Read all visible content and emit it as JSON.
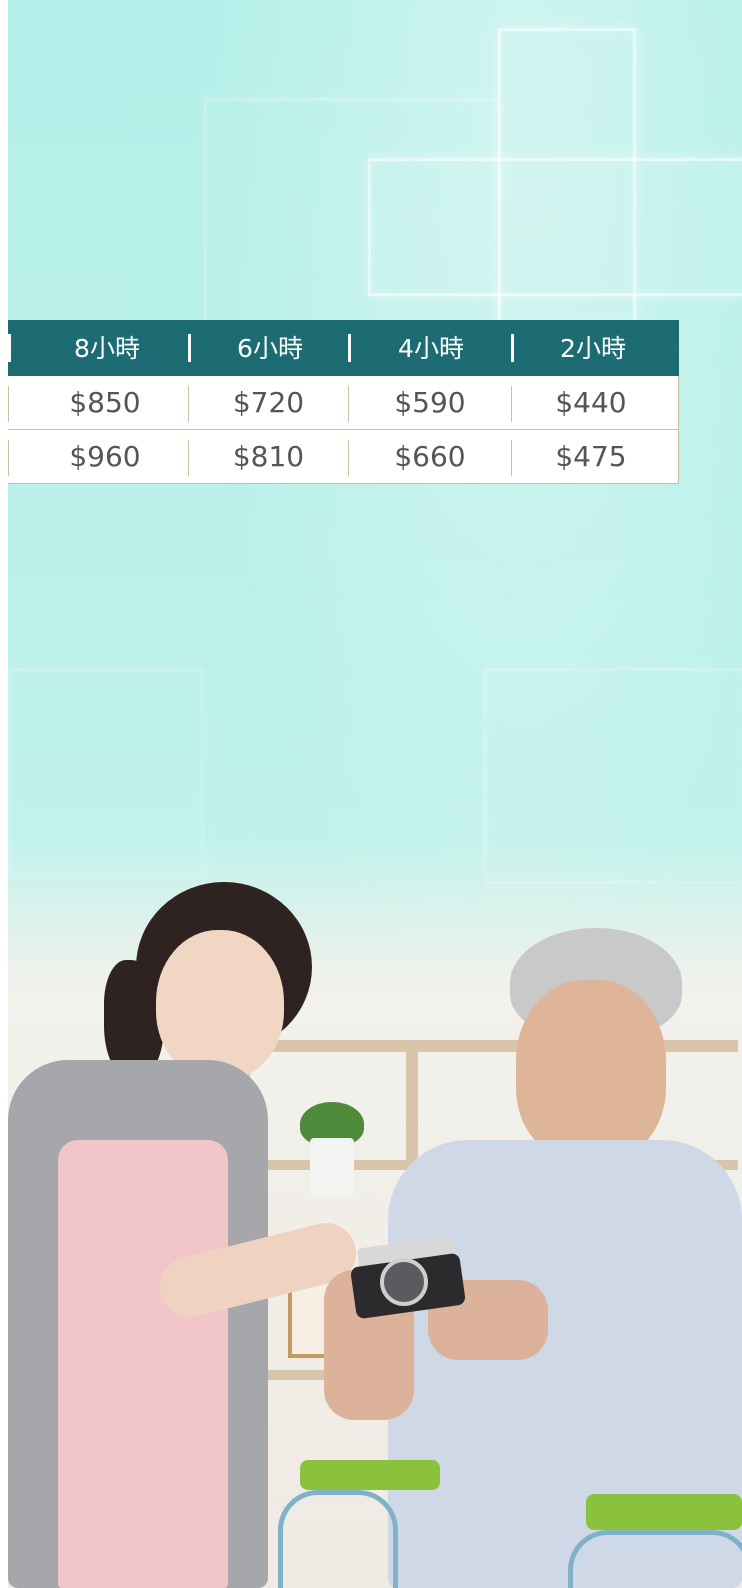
{
  "pricing_table": {
    "headers": [
      "8小時",
      "6小時",
      "4小時",
      "2小時"
    ],
    "rows": [
      [
        "$850",
        "$720",
        "$590",
        "$440"
      ],
      [
        "$960",
        "$810",
        "$660",
        "$475"
      ]
    ]
  },
  "colors": {
    "header_bg": "#1d6b73",
    "background": "#b4efe9",
    "table_border": "#c8c2a5",
    "cell_text": "#555555"
  },
  "photo": {
    "icons": [
      "medical-cross-icon"
    ]
  }
}
